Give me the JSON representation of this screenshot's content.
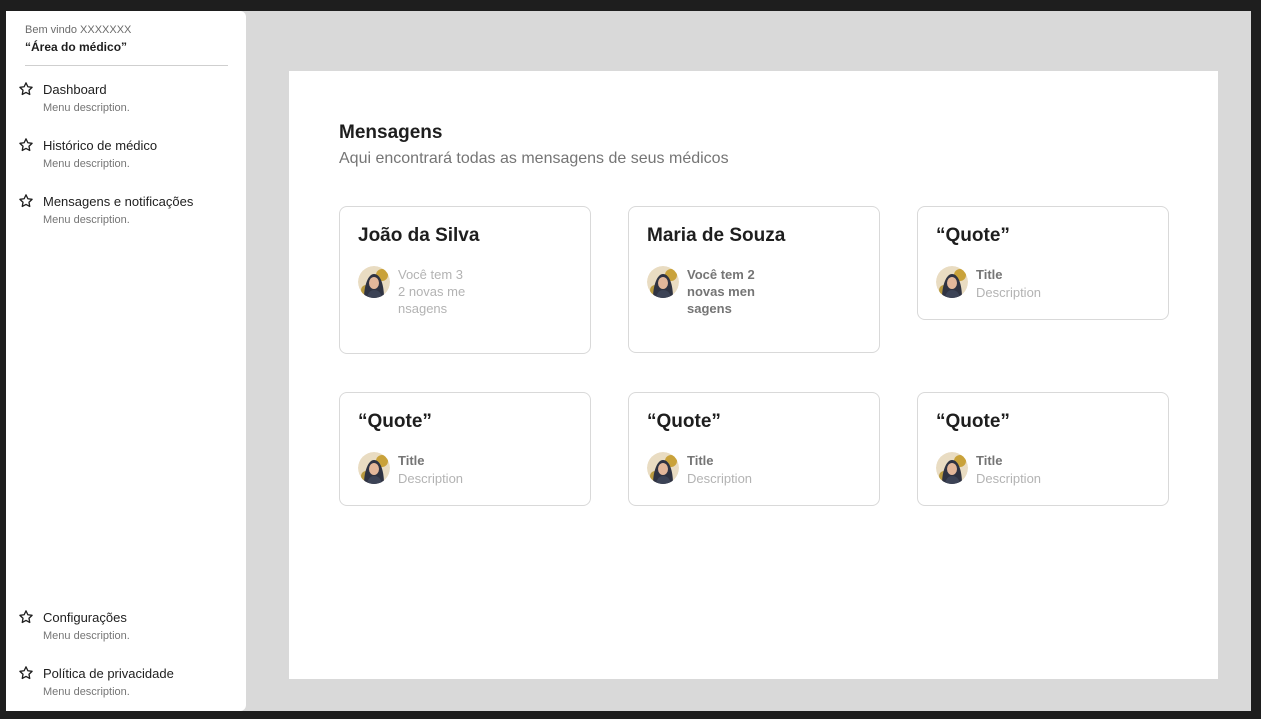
{
  "sidebar": {
    "welcome": "Bem vindo XXXXXXX",
    "area_title": "“Área do médico”",
    "top_items": [
      {
        "label": "Dashboard",
        "description": "Menu description.",
        "icon": "star-icon"
      },
      {
        "label": "Histórico de médico",
        "description": "Menu description.",
        "icon": "star-icon"
      },
      {
        "label": "Mensagens e notificações",
        "description": "Menu description.",
        "icon": "star-icon"
      }
    ],
    "bottom_items": [
      {
        "label": "Configurações",
        "description": "Menu description.",
        "icon": "star-icon"
      },
      {
        "label": "Política de privacidade",
        "description": "Menu description.",
        "icon": "star-icon"
      }
    ]
  },
  "main": {
    "title": "Mensagens",
    "subtitle": "Aqui encontrará todas as mensagens de seus médicos",
    "cards": [
      {
        "title": "João da Silva",
        "text": "Você tem 32 novas mensagens"
      },
      {
        "title": "Maria de Souza",
        "text": "Você tem 2 novas mensagens"
      },
      {
        "title": "“Quote”",
        "info_title": "Title",
        "info_description": "Description"
      },
      {
        "title": "“Quote”",
        "info_title": "Title",
        "info_description": "Description"
      },
      {
        "title": "“Quote”",
        "info_title": "Title",
        "info_description": "Description"
      },
      {
        "title": "“Quote”",
        "info_title": "Title",
        "info_description": "Description"
      }
    ]
  },
  "colors": {
    "frame_background": "#d9d9d9",
    "outer_background": "#1e1e1e",
    "text_primary": "#1e1e1e",
    "text_secondary": "#757575",
    "text_muted": "#b3b3b3"
  }
}
